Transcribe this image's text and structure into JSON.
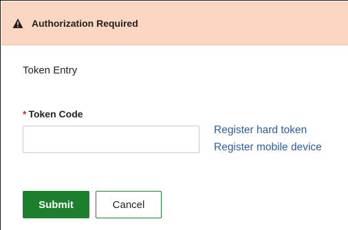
{
  "alert": {
    "icon": "warning-icon",
    "title": "Authorization Required",
    "background_color": "#fbd6c3"
  },
  "form": {
    "section_title": "Token Entry",
    "required_marker": "*",
    "token_label": "Token Code",
    "token_value": "",
    "token_placeholder": ""
  },
  "links": {
    "register_hard_token": "Register hard token",
    "register_mobile_device": "Register mobile device",
    "color": "#2a5d9f"
  },
  "buttons": {
    "submit_label": "Submit",
    "cancel_label": "Cancel",
    "accent_color": "#1c7f2e"
  }
}
